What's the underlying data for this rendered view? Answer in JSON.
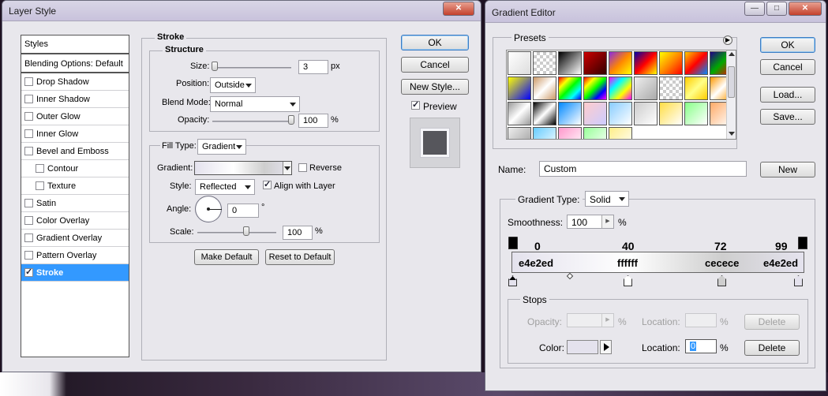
{
  "layer_style": {
    "title": "Layer Style",
    "styles_header": "Styles",
    "blending_options": "Blending Options: Default",
    "items": [
      {
        "label": "Drop Shadow",
        "checked": false
      },
      {
        "label": "Inner Shadow",
        "checked": false
      },
      {
        "label": "Outer Glow",
        "checked": false
      },
      {
        "label": "Inner Glow",
        "checked": false
      },
      {
        "label": "Bevel and Emboss",
        "checked": false
      },
      {
        "label": "Contour",
        "checked": false
      },
      {
        "label": "Texture",
        "checked": false
      },
      {
        "label": "Satin",
        "checked": false
      },
      {
        "label": "Color Overlay",
        "checked": false
      },
      {
        "label": "Gradient Overlay",
        "checked": false
      },
      {
        "label": "Pattern Overlay",
        "checked": false
      },
      {
        "label": "Stroke",
        "checked": true
      }
    ],
    "stroke": {
      "section_title": "Stroke",
      "structure_title": "Structure",
      "size_label": "Size:",
      "size_value": "3",
      "size_unit": "px",
      "position_label": "Position:",
      "position_value": "Outside",
      "blend_mode_label": "Blend Mode:",
      "blend_mode_value": "Normal",
      "opacity_label": "Opacity:",
      "opacity_value": "100",
      "opacity_unit": "%",
      "fill_type_label": "Fill Type:",
      "fill_type_value": "Gradient",
      "gradient_label": "Gradient:",
      "reverse_label": "Reverse",
      "reverse_checked": false,
      "style_label": "Style:",
      "style_value": "Reflected",
      "align_label": "Align with Layer",
      "align_checked": true,
      "angle_label": "Angle:",
      "angle_value": "0",
      "angle_unit": "°",
      "scale_label": "Scale:",
      "scale_value": "100",
      "scale_unit": "%",
      "make_default": "Make Default",
      "reset_default": "Reset to Default"
    },
    "buttons": {
      "ok": "OK",
      "cancel": "Cancel",
      "new_style": "New Style...",
      "preview": "Preview",
      "preview_checked": true
    }
  },
  "gradient_editor": {
    "title": "Gradient Editor",
    "presets_label": "Presets",
    "buttons": {
      "ok": "OK",
      "cancel": "Cancel",
      "load": "Load...",
      "save": "Save...",
      "new": "New"
    },
    "name_label": "Name:",
    "name_value": "Custom",
    "gradient_type_label": "Gradient Type:",
    "gradient_type_value": "Solid",
    "smoothness_label": "Smoothness:",
    "smoothness_value": "100",
    "smoothness_unit": "%",
    "stop_locations": [
      "0",
      "40",
      "72",
      "99"
    ],
    "stop_colors": [
      "e4e2ed",
      "ffffff",
      "cecece",
      "e4e2ed"
    ],
    "stops_group": {
      "title": "Stops",
      "opacity_label": "Opacity:",
      "opacity_unit": "%",
      "location_label": "Location:",
      "location_unit": "%",
      "delete": "Delete",
      "color_label": "Color:",
      "color_location_value": "0",
      "color_swatch": "#e4e2ed"
    }
  }
}
